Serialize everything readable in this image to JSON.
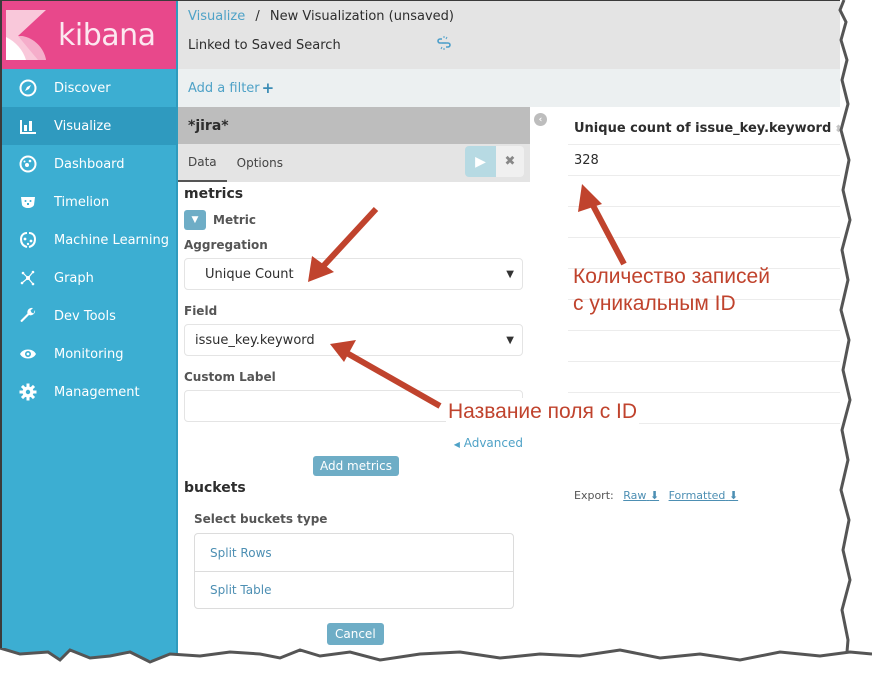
{
  "app": {
    "brand_name": "kibana",
    "brand_color": "#e8488b",
    "sidebar_color": "#3caed2"
  },
  "sidebar": {
    "items": [
      {
        "label": "Discover",
        "icon": "compass-icon",
        "active": false
      },
      {
        "label": "Visualize",
        "icon": "bar-chart-icon",
        "active": true
      },
      {
        "label": "Dashboard",
        "icon": "dashboard-gauge-icon",
        "active": false
      },
      {
        "label": "Timelion",
        "icon": "timelion-bear-icon",
        "active": false
      },
      {
        "label": "Machine Learning",
        "icon": "machine-learning-icon",
        "active": false
      },
      {
        "label": "Graph",
        "icon": "graph-network-icon",
        "active": false
      },
      {
        "label": "Dev Tools",
        "icon": "wrench-icon",
        "active": false
      },
      {
        "label": "Monitoring",
        "icon": "eye-icon",
        "active": false
      },
      {
        "label": "Management",
        "icon": "gear-icon",
        "active": false
      }
    ]
  },
  "header": {
    "breadcrumb": {
      "parent": "Visualize",
      "separator": "/",
      "current": "New Visualization (unsaved)"
    },
    "linked_text": "Linked to Saved Search",
    "unlink_icon": "unlink-icon"
  },
  "filter_bar": {
    "add_filter_label": "Add a filter",
    "plus_icon": "+"
  },
  "editor": {
    "index_pattern": "*jira*",
    "tabs": [
      {
        "label": "Data",
        "active": true
      },
      {
        "label": "Options",
        "active": false
      }
    ],
    "run_icon": "▶",
    "discard_icon": "✖",
    "metrics_title": "metrics",
    "metric_toggle_label": "Metric",
    "aggregation_label": "Aggregation",
    "aggregation_value": "Unique Count",
    "field_label": "Field",
    "field_value": "issue_key.keyword",
    "custom_label_label": "Custom Label",
    "custom_label_value": "",
    "advanced_label": "Advanced",
    "add_metrics_label": "Add metrics",
    "buckets_title": "buckets",
    "select_buckets_label": "Select buckets type",
    "bucket_types": [
      "Split Rows",
      "Split Table"
    ],
    "cancel_label": "Cancel"
  },
  "visualization": {
    "column_header": "Unique count of issue_key.keyword",
    "rows": [
      "328",
      "",
      "",
      "",
      "",
      "",
      "",
      "",
      ""
    ],
    "export_label": "Export:",
    "export_raw": "Raw",
    "export_formatted": "Formatted"
  },
  "annotations": {
    "color": "#c0432d",
    "count_note_line1": "Количество записей",
    "count_note_line2": "с уникальным ID",
    "field_note": "Название поля с ID"
  }
}
